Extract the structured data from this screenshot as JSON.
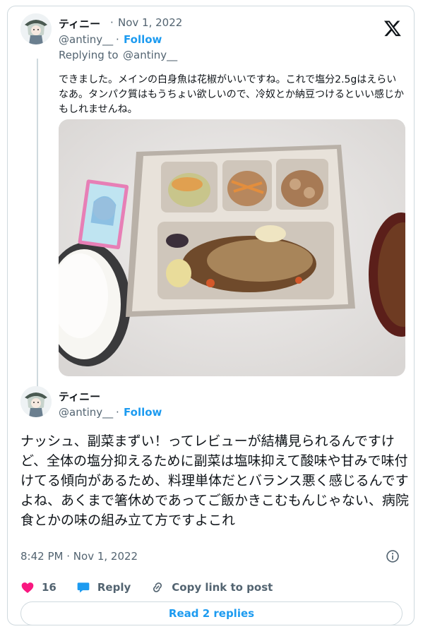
{
  "app": {
    "logo_icon": "x-logo-icon"
  },
  "reply_tweet": {
    "display_name": "ティニー",
    "separator": "·",
    "date": "Nov 1, 2022",
    "handle": "@antiny__",
    "follow_label": "Follow",
    "replying_to_prefix": "Replying to",
    "replying_to_handle": "@antiny__",
    "text": "できました。メインの白身魚は花椒がいいですね。これで塩分2.5gはえらいなあ。タンパク質はもうちょい欲しいので、冷奴とか納豆つけるといい感じかもしれませんね。",
    "photo_icon": "meal-photo"
  },
  "main_tweet": {
    "display_name": "ティニー",
    "handle": "@antiny__",
    "separator": "·",
    "follow_label": "Follow",
    "text": "ナッシュ、副菜まずい！ってレビューが結構見られるんですけど、全体の塩分抑えるために副菜は塩味抑えて酸味や甘みで味付けてる傾向があるため、料理単体だとバランス悪く感じるんですよね、あくまで箸休めであってご飯かきこむもんじゃない、病院食とかの味の組み立て方ですよこれ",
    "time": "8:42 PM",
    "date": "Nov 1, 2022"
  },
  "actions": {
    "like_count": "16",
    "reply_label": "Reply",
    "copy_link_label": "Copy link to post"
  },
  "read_replies_label": "Read 2 replies",
  "colors": {
    "accent": "#1d9bf0",
    "like": "#f91880",
    "text": "#0f1419",
    "muted": "#536471",
    "border": "#cfd9de"
  }
}
